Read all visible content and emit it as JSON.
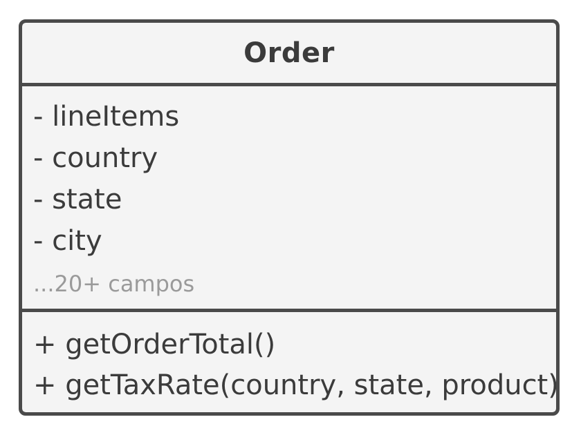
{
  "class": {
    "name": "Order",
    "attributes": [
      "- lineItems",
      "- country",
      "- state",
      "- city"
    ],
    "attributes_note": "...20+ campos",
    "methods": [
      "+ getOrderTotal()",
      "+ getTaxRate(country, state, product)"
    ]
  },
  "colors": {
    "border": "#4a4a4a",
    "fill": "#f4f4f4",
    "text": "#3b3b3b",
    "muted_text": "#9a9a9a"
  }
}
